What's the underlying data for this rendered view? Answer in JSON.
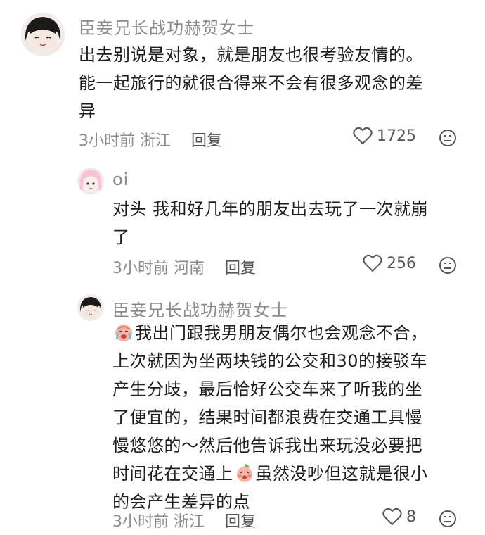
{
  "comments": [
    {
      "username": "臣妾兄长战功赫贺女士",
      "lines": [
        "出去别说是对象，就是朋友也很考验友情的。",
        "能一起旅行的就很合得来不会有很多观念的差",
        "异"
      ],
      "time_location": "3小时前 浙江",
      "reply_label": "回复",
      "likes": "1725"
    },
    {
      "username": "oi",
      "lines": [
        "对头 我和好几年的朋友出去玩了一次就崩",
        "了"
      ],
      "time_location": "3小时前 河南",
      "reply_label": "回复",
      "likes": "256"
    },
    {
      "username": "臣妾兄长战功赫贺女士",
      "line1_after_emoji": "我出门跟我男朋友偶尔也会观念不合，",
      "lines_mid": [
        "上次就因为坐两块钱的公交和30的接驳车",
        "产生分歧，最后恰好公交车来了听我的坐",
        "了便宜的，结果时间都浪费在交通工具慢",
        "慢悠悠的～然后他告诉我出来玩没必要把"
      ],
      "line6_before_emoji": "时间花在交通上",
      "line6_after_emoji": "虽然没吵但这就是很小",
      "line7": "的会产生差异的点",
      "time_location": "3小时前 浙江",
      "reply_label": "回复",
      "likes": "8"
    }
  ],
  "icons": {
    "like": "heart-outline-icon",
    "dislike": "frown-face-icon",
    "emoji_crying": "crying-face-emoji",
    "emoji_peach": "peach-face-emoji"
  }
}
